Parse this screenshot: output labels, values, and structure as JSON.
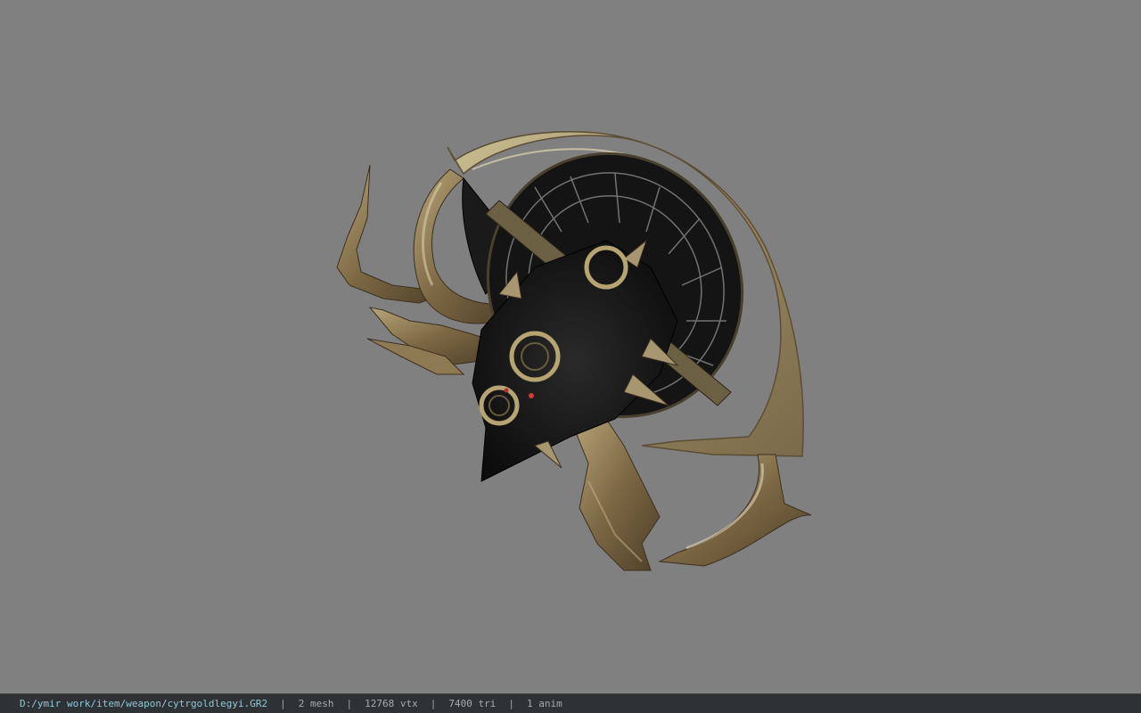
{
  "viewport": {
    "background_color": "#808080",
    "model_icon": "weapon-model-icon"
  },
  "statusbar": {
    "file_path": "D:/ymir work/item/weapon/cytrgoldlegyi.GR2",
    "separator": "|",
    "mesh_count": "2 mesh",
    "vertex_count": "12768 vtx",
    "triangle_count": "7400 tri",
    "anim_count": "1 anim",
    "path_color": "#8fc8d8",
    "background_color": "#2e3234"
  }
}
